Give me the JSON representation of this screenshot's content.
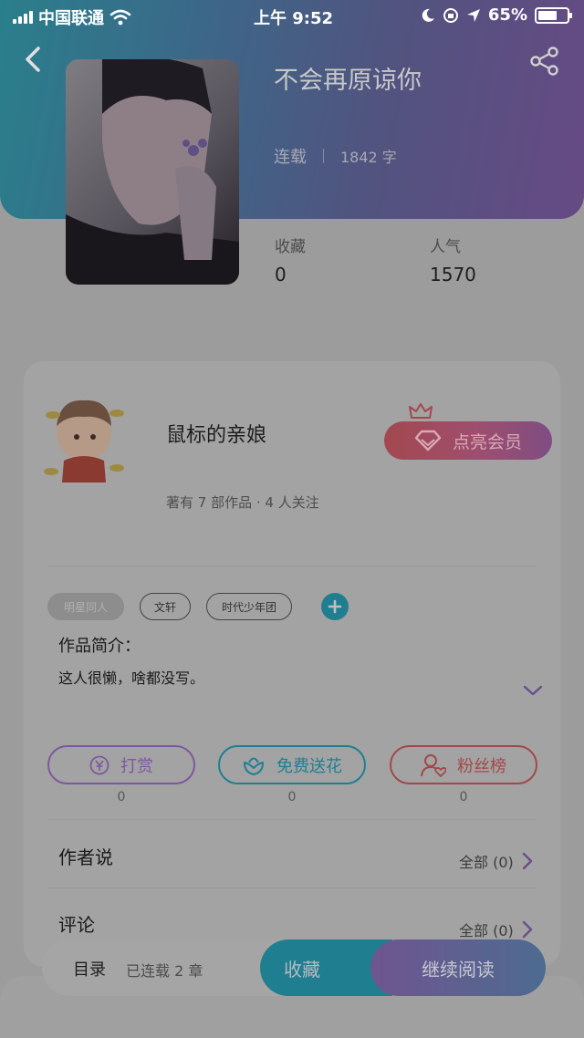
{
  "status_bar": {
    "carrier": "中国联通",
    "time": "上午 9:52",
    "battery": "65%",
    "battery_level": 0.65
  },
  "book": {
    "title": "不会再原谅你",
    "status": "连载",
    "word_count": "1842 字",
    "stats": [
      {
        "label": "收藏",
        "value": "0"
      },
      {
        "label": "人气",
        "value": "1570"
      }
    ]
  },
  "author": {
    "name": "鼠标的亲娘",
    "summary": "著有 7 部作品 · 4 人关注",
    "vip_button": "点亮会员"
  },
  "tags": [
    {
      "label": "明星同人",
      "selected": true
    },
    {
      "label": "文轩",
      "selected": false
    },
    {
      "label": "时代少年团",
      "selected": false
    }
  ],
  "intro": {
    "label": "作品简介：",
    "text": "这人很懒，啥都没写。"
  },
  "actions": [
    {
      "label": "打赏",
      "count": "0",
      "icon": "yen-coin-icon",
      "color": "#7c58a0"
    },
    {
      "label": "免费送花",
      "count": "0",
      "icon": "flower-icon",
      "color": "#1e7f93"
    },
    {
      "label": "粉丝榜",
      "count": "0",
      "icon": "fans-ranking-icon",
      "color": "#a34848"
    }
  ],
  "sections": [
    {
      "title": "作者说",
      "link": "全部 (0)"
    },
    {
      "title": "评论",
      "link": "全部 (0)"
    }
  ],
  "bottom_bar": {
    "toc_label": "目录",
    "chapters": "已连载 2 章",
    "favorite_label": "收藏",
    "read_label": "继续阅读"
  },
  "colors": {
    "accent_teal": "#1f7f90",
    "accent_purple": "#6f5590",
    "vip_red": "#a3484f"
  }
}
